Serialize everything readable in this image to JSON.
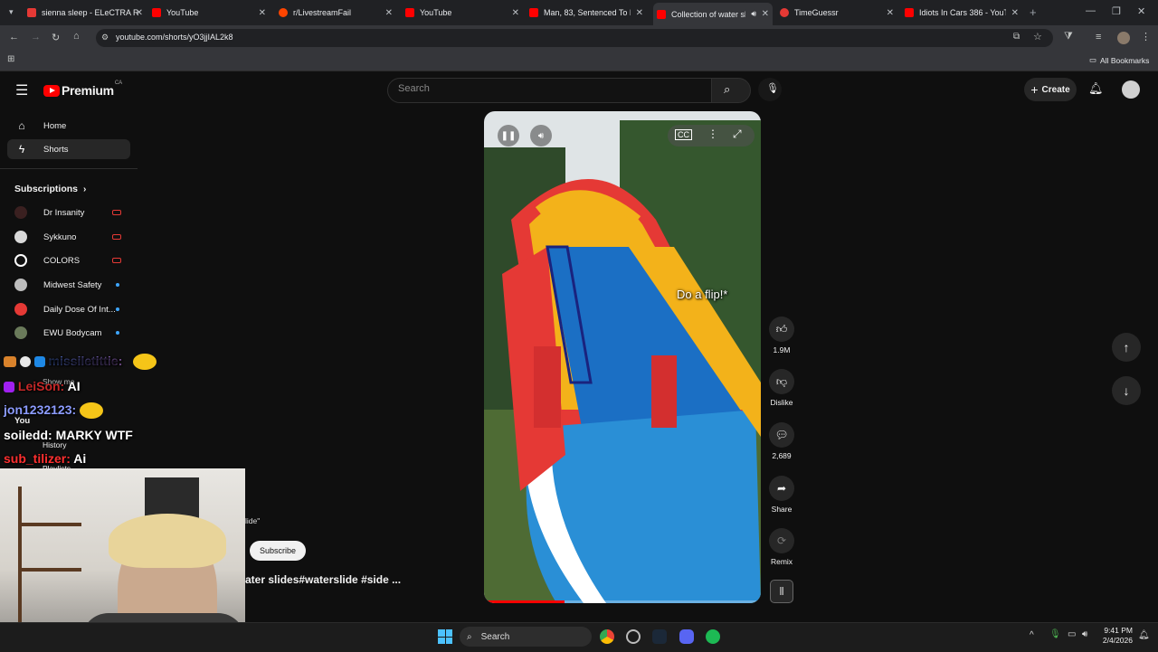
{
  "browser": {
    "tabs": [
      {
        "title": "sienna sleep - ELeCTRA R",
        "color": "#e53935",
        "active": false
      },
      {
        "title": "YouTube",
        "color": "#ff0000",
        "active": false
      },
      {
        "title": "r/LivestreamFail",
        "color": "#ff4500",
        "active": false
      },
      {
        "title": "YouTube",
        "color": "#ff0000",
        "active": false
      },
      {
        "title": "Man, 83, Sentenced To Li",
        "color": "#ff0000",
        "active": false
      },
      {
        "title": "Collection of water sli",
        "color": "#ff0000",
        "active": true
      },
      {
        "title": "TimeGuessr",
        "color": "#e53935",
        "active": false
      },
      {
        "title": "Idiots In Cars 386 - YouTu",
        "color": "#ff0000",
        "active": false
      }
    ],
    "url": "youtube.com/shorts/yO3jjIAL2k8",
    "bookmarks_label": "All Bookmarks"
  },
  "youtube": {
    "logo_text": "Premium",
    "logo_country": "CA",
    "search_placeholder": "Search",
    "create_label": "Create",
    "nav": [
      {
        "label": "Home",
        "icon": "home-icon"
      },
      {
        "label": "Shorts",
        "icon": "shorts-icon",
        "selected": true
      }
    ],
    "subscriptions_title": "Subscriptions",
    "subscriptions": [
      {
        "name": "Dr Insanity",
        "avatar_color": "#3a2020",
        "status": "live"
      },
      {
        "name": "Sykkuno",
        "avatar_color": "#d9d9d9",
        "status": "live"
      },
      {
        "name": "COLORS",
        "avatar_color": "#ffffff",
        "status": "live"
      },
      {
        "name": "Midwest Safety",
        "avatar_color": "#bdbdbd",
        "status": "new"
      },
      {
        "name": "Daily Dose Of Int...",
        "avatar_color": "#e53935",
        "status": "new"
      },
      {
        "name": "EWU Bodycam",
        "avatar_color": "#6a7a5a",
        "status": "new"
      }
    ],
    "sidebar_partial": {
      "show_more": "Show mo",
      "you": "You",
      "history": "History",
      "playlists": "Playlists"
    },
    "short": {
      "caption": "Do a flip!*",
      "subscribe_label": "Subscribe",
      "title_fragment": "ater slides#waterslide #side ...",
      "channel_fragment": "lide\"",
      "progress_fraction": 0.29
    },
    "actions": [
      {
        "icon": "thumbs-up-icon",
        "label": "1.9M"
      },
      {
        "icon": "thumbs-down-icon",
        "label": "Dislike"
      },
      {
        "icon": "comment-icon",
        "label": "2,689"
      },
      {
        "icon": "share-icon",
        "label": "Share"
      },
      {
        "icon": "remix-icon",
        "label": "Remix"
      }
    ]
  },
  "chat": [
    {
      "user": "missiletittie:",
      "message": "",
      "color": "#5b8cff"
    },
    {
      "user": "LeiSon:",
      "message": "AI",
      "color": "#a020f0"
    },
    {
      "user": "jon1232123:",
      "message": "",
      "color": "#7b8cff"
    },
    {
      "user": "soiledd:",
      "message": "MARKY WTF",
      "color": "#ffffff"
    },
    {
      "user": "sub_tilizer:",
      "message": "Ai",
      "color": "#e53935"
    }
  ],
  "taskbar": {
    "search_label": "Search",
    "time": "9:41 PM",
    "date": "2/4/2026"
  }
}
